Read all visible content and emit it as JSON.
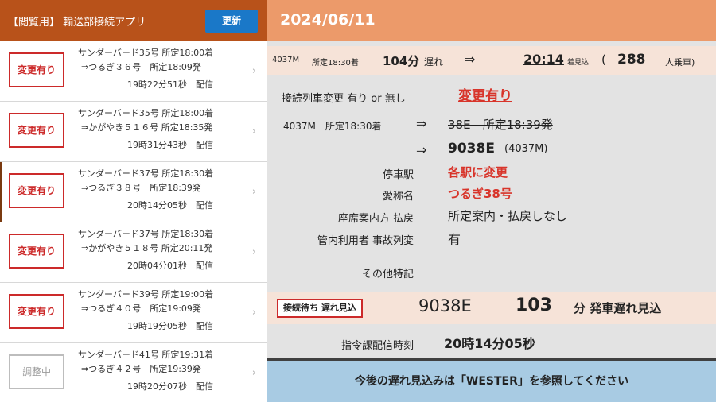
{
  "left_header": {
    "app_title": "【閲覧用】 輸送部接続アプリ",
    "update_label": "更新"
  },
  "trains": [
    {
      "status": "変更有り",
      "line1": "サンダーバード35号 所定18:00着",
      "line2": "⇒つるぎ３６号　所定18:09発",
      "line3": "19時22分51秒　配信",
      "pending": false
    },
    {
      "status": "変更有り",
      "line1": "サンダーバード35号 所定18:00着",
      "line2": "⇒かがやき５１６号 所定18:35発",
      "line3": "19時31分43秒　配信",
      "pending": false
    },
    {
      "status": "変更有り",
      "line1": "サンダーバード37号 所定18:30着",
      "line2": "⇒つるぎ３８号　所定18:39発",
      "line3": "20時14分05秒　配信",
      "pending": false
    },
    {
      "status": "変更有り",
      "line1": "サンダーバード37号 所定18:30着",
      "line2": "⇒かがやき５１８号 所定20:11発",
      "line3": "20時04分01秒　配信",
      "pending": false
    },
    {
      "status": "変更有り",
      "line1": "サンダーバード39号 所定19:00着",
      "line2": "⇒つるぎ４０号　所定19:09発",
      "line3": "19時19分05秒　配信",
      "pending": false
    },
    {
      "status": "調整中",
      "line1": "サンダーバード41号 所定19:31着",
      "line2": "⇒つるぎ４２号　所定19:39発",
      "line3": "19時20分07秒　配信",
      "pending": true
    }
  ],
  "detail": {
    "date": "2024/06/11",
    "summary": {
      "train": "4037M",
      "scheduled": "所定18:30着",
      "delay_min": "104分",
      "delay_word": "遅れ",
      "arrow": "⇒",
      "eta": "20:14",
      "eta_label": "着見込",
      "paren_open": "(",
      "passengers": "288",
      "passengers_label": "人乗車)"
    },
    "connection_label": "接続列車変更 有り or 無し",
    "connection_value": "変更有り",
    "from_train": "4037M　所定18:30着",
    "arrow": "⇒",
    "old_connection": "38E　所定18:39発",
    "new_connection_train": "9038E",
    "new_connection_note": "(4037M)",
    "stops_label": "停車駅",
    "stops_value": "各駅に変更",
    "name_label": "愛称名",
    "name_value": "つるぎ38号",
    "seat_label": "座席案内方 払戻",
    "seat_value": "所定案内・払戻しなし",
    "internal_label": "管内利用者 事故列変",
    "internal_value": "有",
    "other_label": "その他特記",
    "delay_box_label": "接続待ち 遅れ見込",
    "delay_train": "9038E",
    "delay_minutes": "103",
    "delay_suffix": "分 発車遅れ見込",
    "dispatch_label": "指令課配信時刻",
    "dispatch_time": "20時14分05秒",
    "footer": "今後の遅れ見込みは「WESTER」を参照してください"
  },
  "colors": {
    "left_header": "#b8521a",
    "update_button": "#1a78c8",
    "right_header": "#ec9a6a",
    "highlight_band": "#f6e3d8",
    "footer_band": "#a8cbe3",
    "alert_red": "#d8342a"
  },
  "icons": [
    "chevron-right-icon"
  ]
}
